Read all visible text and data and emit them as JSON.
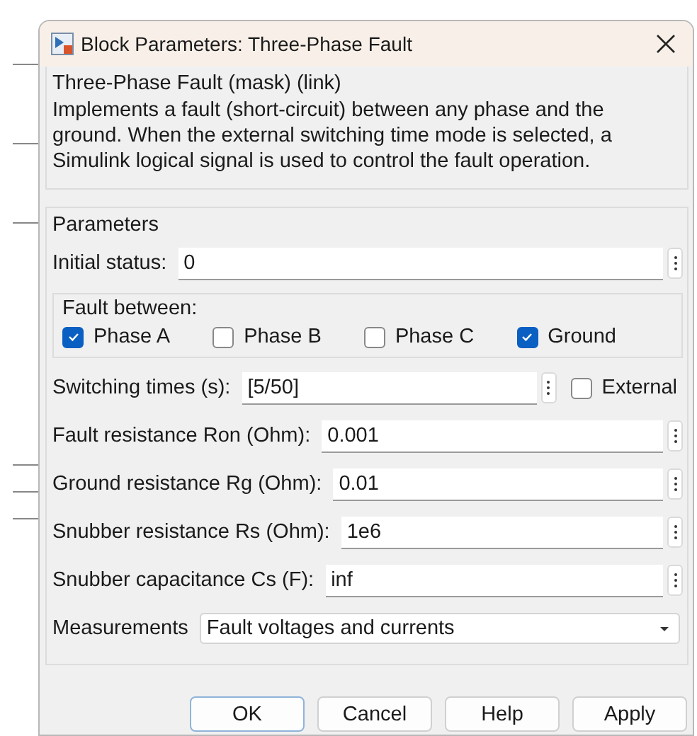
{
  "window": {
    "title": "Block Parameters: Three-Phase Fault"
  },
  "description": {
    "heading": "Three-Phase Fault (mask) (link)",
    "text": "Implements a fault (short-circuit) between any phase and the ground. When the external switching time mode is selected, a Simulink logical signal is used to control the fault operation."
  },
  "parameters": {
    "heading": "Parameters",
    "initial_status": {
      "label": "Initial status:",
      "value": "0"
    },
    "fault_between": {
      "heading": "Fault between:",
      "options": [
        {
          "label": "Phase A",
          "checked": true
        },
        {
          "label": "Phase B",
          "checked": false
        },
        {
          "label": "Phase C",
          "checked": false
        },
        {
          "label": "Ground",
          "checked": true
        }
      ]
    },
    "switching_times": {
      "label": "Switching times (s):",
      "value": "[5/50]",
      "external": {
        "label": "External",
        "checked": false
      }
    },
    "fields": [
      {
        "label": "Fault resistance Ron (Ohm):",
        "value": "0.001"
      },
      {
        "label": "Ground resistance Rg (Ohm):",
        "value": "0.01"
      },
      {
        "label": "Snubber resistance Rs (Ohm):",
        "value": "1e6"
      },
      {
        "label": "Snubber capacitance Cs (F):",
        "value": "inf"
      }
    ],
    "measurements": {
      "label": "Measurements",
      "value": "Fault voltages and currents"
    }
  },
  "buttons": [
    {
      "label": "OK",
      "default": true
    },
    {
      "label": "Cancel",
      "default": false
    },
    {
      "label": "Help",
      "default": false
    },
    {
      "label": "Apply",
      "default": false
    }
  ]
}
